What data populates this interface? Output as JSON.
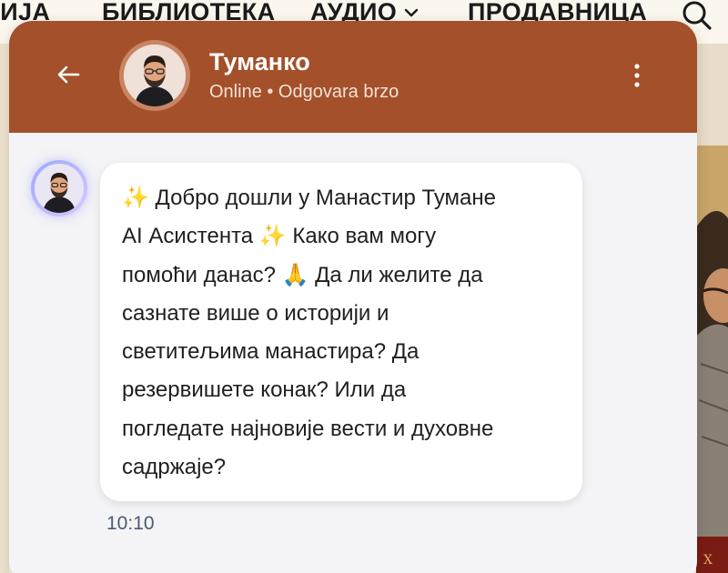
{
  "site_nav": {
    "items": [
      "РИЈА",
      "БИБЛИОТЕКА",
      "АУДИО",
      "ПРОДАВНИЦА"
    ]
  },
  "chat": {
    "header": {
      "agent_name": "Туманко",
      "status": "Online • Odgovara brzo"
    },
    "message": {
      "text": "✨ Добро дошли у Манастир Тумане\nAI Асистента ✨ Како вам могу\nпомоћи данас? 🙏  Да ли желите да\nсазнате више о историји и\nсветитељима манастира?  Да\nрезервишете конак?  Или да\nпогледате најновије вести и духовне\nсадржаје?",
      "time": "10:10"
    }
  },
  "colors": {
    "header_bg": "#a4502a",
    "chat_bg": "#f4f4f6",
    "bubble_bg": "#ffffff"
  }
}
